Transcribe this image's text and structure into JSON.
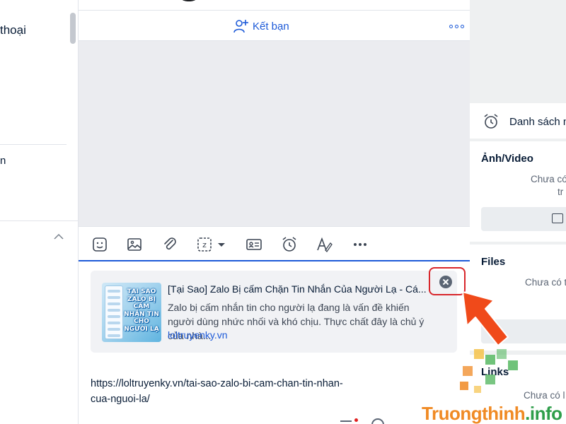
{
  "left_panel": {
    "partial_label_1": "thoại",
    "partial_label_2": "n"
  },
  "header": {
    "add_friend_label": "Kết bạn",
    "more_icon": "more-dots-icon"
  },
  "toolbar": {
    "icons": [
      "sticker-icon",
      "image-icon",
      "attachment-icon",
      "quick-message-icon",
      "contact-card-icon",
      "reminder-icon",
      "text-format-icon",
      "more-icon"
    ]
  },
  "link_preview": {
    "title": "[Tại Sao] Zalo Bị cấm Chặn Tin Nhắn Của Người Lạ - Cá...",
    "description": "Zalo bị cấm nhắn tin cho người lạ đang là vấn đề khiến người dùng nhức nhối và khó chịu. Thực chất đây là chủ ý của nhà...",
    "domain": "loltruyenky.vn",
    "thumbnail_text": "TẠI SAO ZALO BỊ CẤM NHẮN TIN CHO NGƯỜI LẠ"
  },
  "composer": {
    "message_text": "https://loltruyenky.vn/tai-sao-zalo-bi-cam-chan-tin-nhan-cua-nguoi-la/"
  },
  "right_panel": {
    "reminder_label": "Danh sách n",
    "media_title": "Ảnh/Video",
    "media_empty_1": "Chưa có",
    "media_empty_2": "tr",
    "files_title": "Files",
    "files_empty": "Chưa có t",
    "links_title": "Links",
    "links_empty": "Chưa có l"
  },
  "watermark": {
    "brand": "Truongthinh",
    "suffix": ".info"
  },
  "colors": {
    "accent": "#1d5ad8",
    "highlight_red": "#d8262b",
    "arrow_orange": "#f04a1a"
  }
}
